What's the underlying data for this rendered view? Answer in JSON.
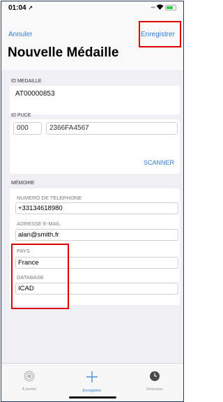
{
  "status": {
    "time": "01:04",
    "arrow": "↗"
  },
  "nav": {
    "cancel_label": "Annuler",
    "save_label": "Enregistrer",
    "title": "Nouvelle Médaille"
  },
  "medal": {
    "section_label": "ID MEDAILLE",
    "value": "AT00000853"
  },
  "puce": {
    "section_label": "ID PUCE",
    "prefix": "000",
    "code": "2366FA4567",
    "scanner_label": "SCANNER"
  },
  "memory": {
    "section_label": "MÉMOIRE",
    "phone_label": "NUMERO DE TELEPHONE",
    "phone_value": "+33134618980",
    "email_label": "ADRESSE E-MAIL",
    "email_value": "alan@smith.fr",
    "country_label": "PAYS",
    "country_value": "France",
    "database_label": "DATABASE",
    "database_value": "ICAD"
  },
  "tabs": [
    {
      "label": "À portée",
      "icon": "radar-icon"
    },
    {
      "label": "Enregistrer",
      "icon": "plus-icon"
    },
    {
      "label": "Historique",
      "icon": "clock-icon"
    }
  ],
  "colors": {
    "accent": "#2f7cd9",
    "highlight": "#e00000",
    "background": "#efeff4"
  }
}
